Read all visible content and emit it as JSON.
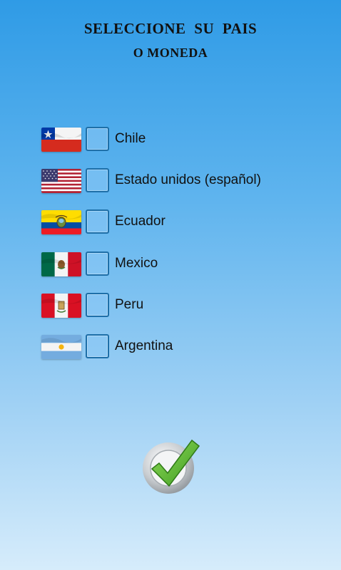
{
  "header": {
    "line1": "SELECCIONE  SU  PAIS",
    "line2": "O MONEDA"
  },
  "countries": [
    {
      "label": "Chile",
      "flag_icon": "chile-flag-icon",
      "checked": false
    },
    {
      "label": "Estado unidos (español)",
      "flag_icon": "usa-flag-icon",
      "checked": false
    },
    {
      "label": "Ecuador",
      "flag_icon": "ecuador-flag-icon",
      "checked": false
    },
    {
      "label": "Mexico",
      "flag_icon": "mexico-flag-icon",
      "checked": false
    },
    {
      "label": "Peru",
      "flag_icon": "peru-flag-icon",
      "checked": false
    },
    {
      "label": "Argentina",
      "flag_icon": "argentina-flag-icon",
      "checked": false
    }
  ],
  "confirm": {
    "icon": "checkmark-icon",
    "accent": "#4caf2a"
  }
}
